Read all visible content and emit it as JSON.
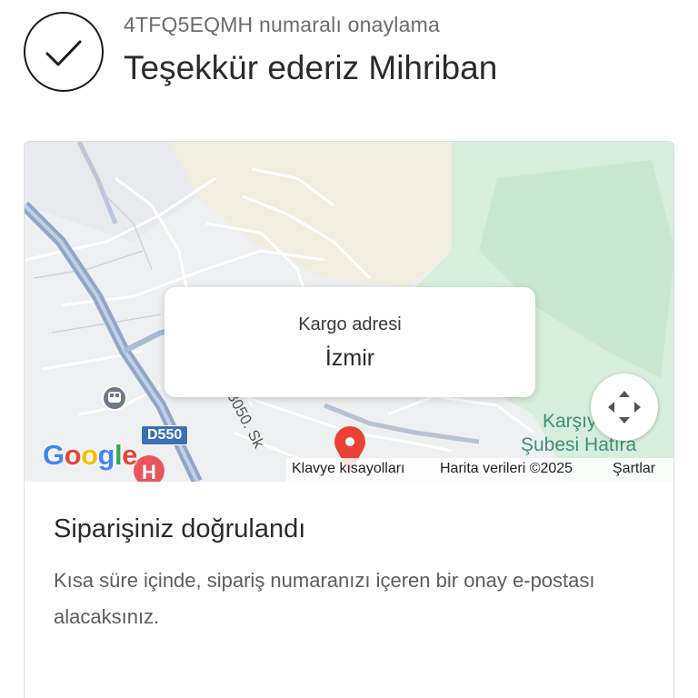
{
  "header": {
    "confirmation_line": "4TFQ5EQMH numaralı onaylama",
    "thanks_line": "Teşekkür ederiz Mihriban",
    "check_icon": "check-circle-icon"
  },
  "map": {
    "popup_label": "Kargo adresi",
    "popup_city": "İzmir",
    "place_line1": "Karşıy",
    "place_line2": "Şubesi Hatıra",
    "road_label": "3050. Sk",
    "highway_shield": "D550",
    "google_logo": "Google",
    "attribution": {
      "shortcuts": "Klavye kısayolları",
      "map_data": "Harita verileri ©2025",
      "terms": "Şartlar"
    },
    "icons": {
      "fullscreen": "fullscreen-icon",
      "marker": "location-pin-icon",
      "hospital": "hospital-icon",
      "transit": "transit-icon"
    },
    "colors": {
      "park_green": "#d3ecd9",
      "road_blue": "#8fa6c9",
      "marker_red": "#ea4335"
    }
  },
  "confirmation": {
    "title": "Siparişiniz doğrulandı",
    "body": "Kısa süre içinde, sipariş numaranızı içeren bir onay e-postası alacaksınız."
  }
}
